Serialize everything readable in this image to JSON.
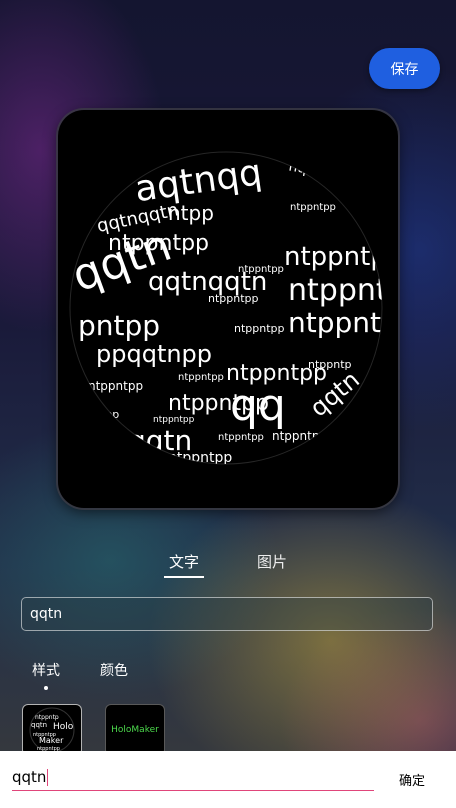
{
  "toolbar": {
    "save_label": "保存"
  },
  "tabs": [
    {
      "label": "文字",
      "active": true
    },
    {
      "label": "图片",
      "active": false
    }
  ],
  "text_input": {
    "value": "qqtn"
  },
  "style_tabs": [
    {
      "label": "样式",
      "active": true
    },
    {
      "label": "颜色",
      "active": false
    }
  ],
  "style_options": [
    {
      "name": "sphere-text"
    },
    {
      "name": "holomaker",
      "label": "HoloMaker"
    }
  ],
  "ime": {
    "value": "qqtn",
    "confirm_label": "确定"
  },
  "colors": {
    "accent": "#1f5fe0",
    "ime_underline": "#e0457a",
    "holo_green": "#4cd94c"
  }
}
